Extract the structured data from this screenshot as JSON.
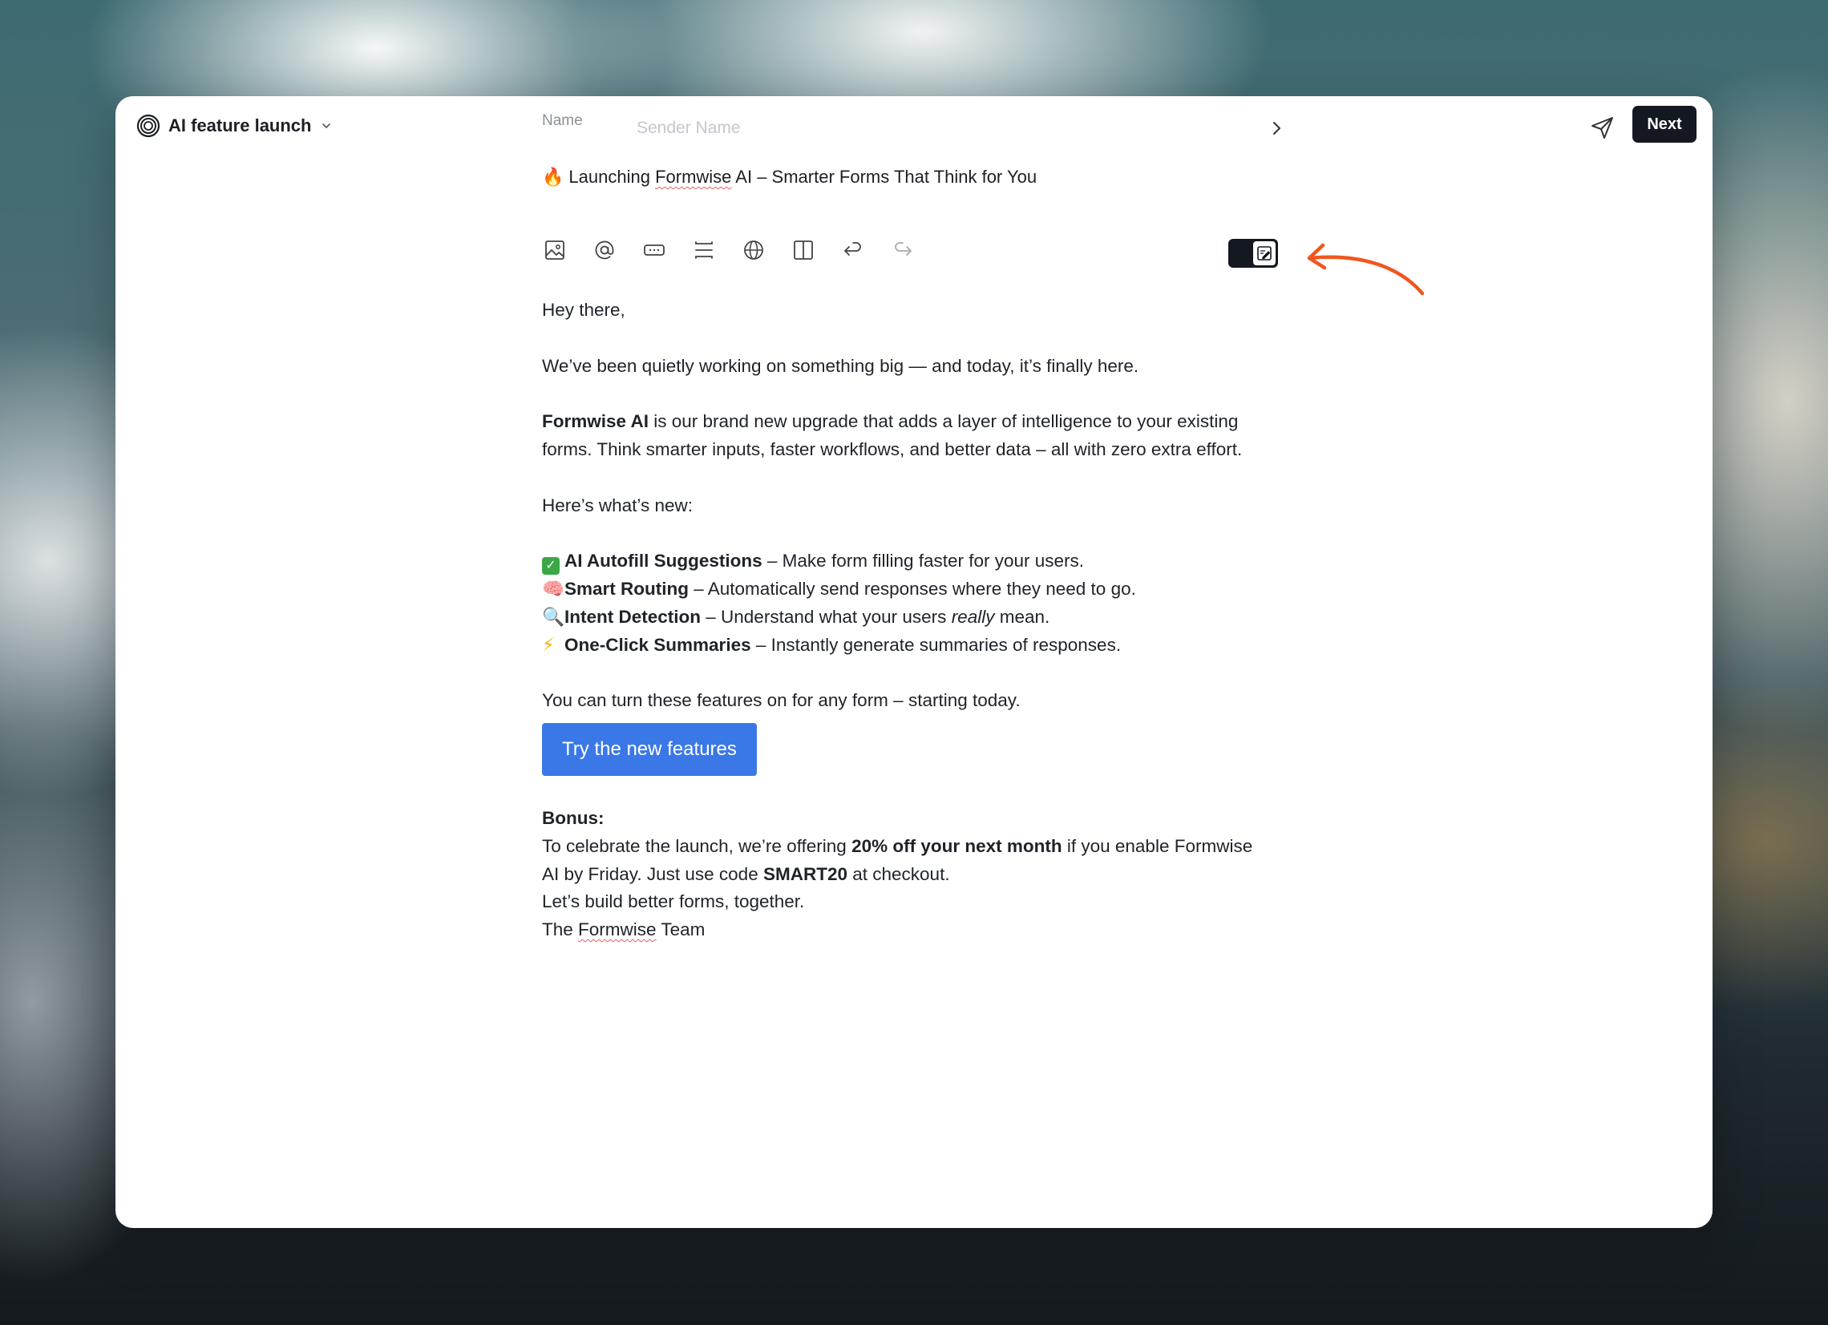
{
  "header": {
    "campaign_title": "AI feature launch",
    "name_label": "Name",
    "name_placeholder": "Sender Name",
    "next_label": "Next"
  },
  "subject": {
    "emoji": "🔥",
    "pre": "Launching ",
    "brand": "Formwise",
    "post": " AI – Smarter Forms That Think for You"
  },
  "toolbar": {
    "icons": [
      "image-icon",
      "mention-icon",
      "button-block-icon",
      "divider-icon",
      "globe-icon",
      "columns-icon",
      "undo-icon",
      "redo-icon"
    ]
  },
  "email": {
    "greeting": "Hey there,",
    "intro": "We’ve been quietly working on something big — and today, it’s finally here.",
    "para_bold": "Formwise AI",
    "para_rest": " is our brand new upgrade that adds a layer of intelligence to your existing forms. Think smarter inputs, faster workflows, and better data – all with zero extra effort.",
    "whats_new": "Here’s what’s new:",
    "features": [
      {
        "emoji": "✓",
        "title": "AI Autofill Suggestions",
        "desc": " – Make form filling faster for your users."
      },
      {
        "emoji": "🧠",
        "title": "Smart Routing",
        "desc": " – Automatically send responses where they need to go."
      },
      {
        "emoji": "🔍",
        "title": "Intent Detection",
        "desc": " – Understand what your users ",
        "desc_italic": "really",
        "desc_end": " mean."
      },
      {
        "emoji": "⚡",
        "title": "One-Click Summaries",
        "desc": " – Instantly generate summaries of responses."
      }
    ],
    "turn_on": "You can turn these features on for any form – starting today.",
    "cta_label": "Try the new features",
    "bonus_label": "Bonus:",
    "bonus_pre": "To celebrate the launch, we’re offering ",
    "bonus_bold": "20% off your next month",
    "bonus_mid": " if you enable Formwise AI by Friday. Just use code ",
    "bonus_code": "SMART20",
    "bonus_end": " at checkout.",
    "closing": "Let’s build better forms, together.",
    "signoff_pre": "The ",
    "signoff_brand": "Formwise",
    "signoff_post": " Team"
  },
  "colors": {
    "accent_button": "#3b78e7",
    "dark_button": "#141820",
    "annotation_arrow": "#f0561e"
  }
}
